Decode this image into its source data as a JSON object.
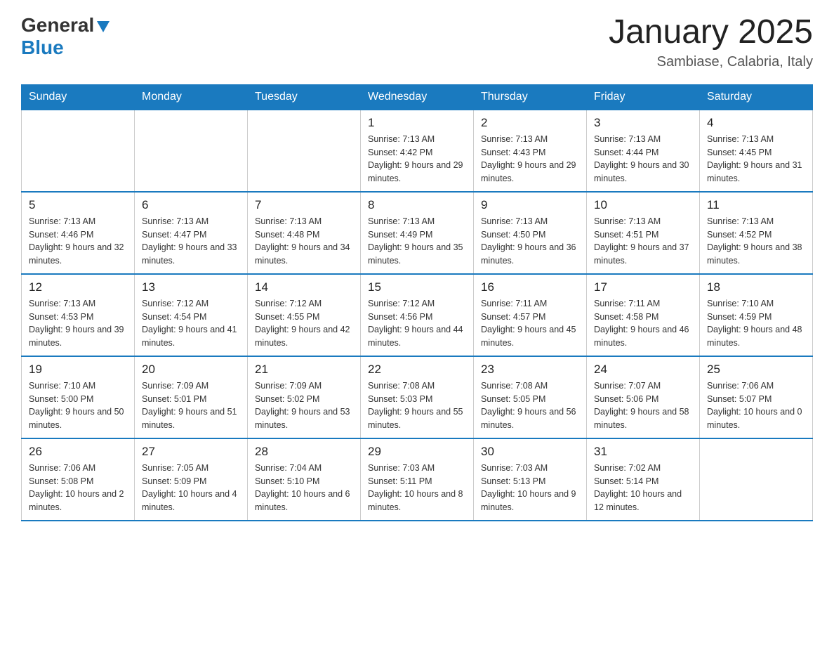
{
  "header": {
    "logo_general": "General",
    "logo_blue": "Blue",
    "month_title": "January 2025",
    "location": "Sambiase, Calabria, Italy"
  },
  "weekdays": [
    "Sunday",
    "Monday",
    "Tuesday",
    "Wednesday",
    "Thursday",
    "Friday",
    "Saturday"
  ],
  "weeks": [
    [
      {
        "day": "",
        "info": ""
      },
      {
        "day": "",
        "info": ""
      },
      {
        "day": "",
        "info": ""
      },
      {
        "day": "1",
        "info": "Sunrise: 7:13 AM\nSunset: 4:42 PM\nDaylight: 9 hours\nand 29 minutes."
      },
      {
        "day": "2",
        "info": "Sunrise: 7:13 AM\nSunset: 4:43 PM\nDaylight: 9 hours\nand 29 minutes."
      },
      {
        "day": "3",
        "info": "Sunrise: 7:13 AM\nSunset: 4:44 PM\nDaylight: 9 hours\nand 30 minutes."
      },
      {
        "day": "4",
        "info": "Sunrise: 7:13 AM\nSunset: 4:45 PM\nDaylight: 9 hours\nand 31 minutes."
      }
    ],
    [
      {
        "day": "5",
        "info": "Sunrise: 7:13 AM\nSunset: 4:46 PM\nDaylight: 9 hours\nand 32 minutes."
      },
      {
        "day": "6",
        "info": "Sunrise: 7:13 AM\nSunset: 4:47 PM\nDaylight: 9 hours\nand 33 minutes."
      },
      {
        "day": "7",
        "info": "Sunrise: 7:13 AM\nSunset: 4:48 PM\nDaylight: 9 hours\nand 34 minutes."
      },
      {
        "day": "8",
        "info": "Sunrise: 7:13 AM\nSunset: 4:49 PM\nDaylight: 9 hours\nand 35 minutes."
      },
      {
        "day": "9",
        "info": "Sunrise: 7:13 AM\nSunset: 4:50 PM\nDaylight: 9 hours\nand 36 minutes."
      },
      {
        "day": "10",
        "info": "Sunrise: 7:13 AM\nSunset: 4:51 PM\nDaylight: 9 hours\nand 37 minutes."
      },
      {
        "day": "11",
        "info": "Sunrise: 7:13 AM\nSunset: 4:52 PM\nDaylight: 9 hours\nand 38 minutes."
      }
    ],
    [
      {
        "day": "12",
        "info": "Sunrise: 7:13 AM\nSunset: 4:53 PM\nDaylight: 9 hours\nand 39 minutes."
      },
      {
        "day": "13",
        "info": "Sunrise: 7:12 AM\nSunset: 4:54 PM\nDaylight: 9 hours\nand 41 minutes."
      },
      {
        "day": "14",
        "info": "Sunrise: 7:12 AM\nSunset: 4:55 PM\nDaylight: 9 hours\nand 42 minutes."
      },
      {
        "day": "15",
        "info": "Sunrise: 7:12 AM\nSunset: 4:56 PM\nDaylight: 9 hours\nand 44 minutes."
      },
      {
        "day": "16",
        "info": "Sunrise: 7:11 AM\nSunset: 4:57 PM\nDaylight: 9 hours\nand 45 minutes."
      },
      {
        "day": "17",
        "info": "Sunrise: 7:11 AM\nSunset: 4:58 PM\nDaylight: 9 hours\nand 46 minutes."
      },
      {
        "day": "18",
        "info": "Sunrise: 7:10 AM\nSunset: 4:59 PM\nDaylight: 9 hours\nand 48 minutes."
      }
    ],
    [
      {
        "day": "19",
        "info": "Sunrise: 7:10 AM\nSunset: 5:00 PM\nDaylight: 9 hours\nand 50 minutes."
      },
      {
        "day": "20",
        "info": "Sunrise: 7:09 AM\nSunset: 5:01 PM\nDaylight: 9 hours\nand 51 minutes."
      },
      {
        "day": "21",
        "info": "Sunrise: 7:09 AM\nSunset: 5:02 PM\nDaylight: 9 hours\nand 53 minutes."
      },
      {
        "day": "22",
        "info": "Sunrise: 7:08 AM\nSunset: 5:03 PM\nDaylight: 9 hours\nand 55 minutes."
      },
      {
        "day": "23",
        "info": "Sunrise: 7:08 AM\nSunset: 5:05 PM\nDaylight: 9 hours\nand 56 minutes."
      },
      {
        "day": "24",
        "info": "Sunrise: 7:07 AM\nSunset: 5:06 PM\nDaylight: 9 hours\nand 58 minutes."
      },
      {
        "day": "25",
        "info": "Sunrise: 7:06 AM\nSunset: 5:07 PM\nDaylight: 10 hours\nand 0 minutes."
      }
    ],
    [
      {
        "day": "26",
        "info": "Sunrise: 7:06 AM\nSunset: 5:08 PM\nDaylight: 10 hours\nand 2 minutes."
      },
      {
        "day": "27",
        "info": "Sunrise: 7:05 AM\nSunset: 5:09 PM\nDaylight: 10 hours\nand 4 minutes."
      },
      {
        "day": "28",
        "info": "Sunrise: 7:04 AM\nSunset: 5:10 PM\nDaylight: 10 hours\nand 6 minutes."
      },
      {
        "day": "29",
        "info": "Sunrise: 7:03 AM\nSunset: 5:11 PM\nDaylight: 10 hours\nand 8 minutes."
      },
      {
        "day": "30",
        "info": "Sunrise: 7:03 AM\nSunset: 5:13 PM\nDaylight: 10 hours\nand 9 minutes."
      },
      {
        "day": "31",
        "info": "Sunrise: 7:02 AM\nSunset: 5:14 PM\nDaylight: 10 hours\nand 12 minutes."
      },
      {
        "day": "",
        "info": ""
      }
    ]
  ]
}
